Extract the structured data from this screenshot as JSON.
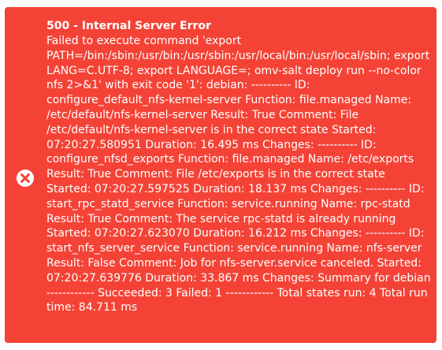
{
  "notification": {
    "type": "error",
    "icon": "error-circle-icon",
    "colors": {
      "background": "#f44336",
      "text": "#ffffff"
    },
    "title": "500 - Internal Server Error",
    "message": "Failed to execute command 'export PATH=/bin:/sbin:/usr/bin:/usr/sbin:/usr/local/bin:/usr/local/sbin; export LANG=C.UTF-8; export LANGUAGE=; omv-salt deploy run --no-color nfs 2>&1' with exit code '1': debian: ---------- ID: configure_default_nfs-kernel-server Function: file.managed Name: /etc/default/nfs-kernel-server Result: True Comment: File /etc/default/nfs-kernel-server is in the correct state Started: 07:20:27.580951 Duration: 16.495 ms Changes: ---------- ID: configure_nfsd_exports Function: file.managed Name: /etc/exports Result: True Comment: File /etc/exports is in the correct state Started: 07:20:27.597525 Duration: 18.137 ms Changes: ---------- ID: start_rpc_statd_service Function: service.running Name: rpc-statd Result: True Comment: The service rpc-statd is already running Started: 07:20:27.623070 Duration: 16.212 ms Changes: ---------- ID: start_nfs_server_service Function: service.running Name: nfs-server Result: False Comment: Job for nfs-server.service canceled. Started: 07:20:27.639776 Duration: 33.867 ms Changes: Summary for debian ------------ Succeeded: 3 Failed: 1 ------------ Total states run: 4 Total run time: 84.711 ms"
  }
}
